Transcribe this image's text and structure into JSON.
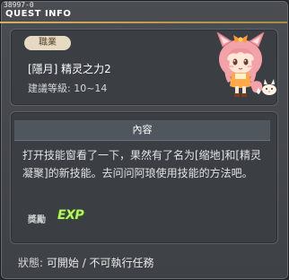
{
  "window": {
    "quest_id": "38997-0",
    "title": "QUEST INFO"
  },
  "job": {
    "badge_label": "職業",
    "name": "[隱月] 精灵之力2",
    "level_recommend": "建議等級: 10~14"
  },
  "content": {
    "header_label": "內容",
    "body_line1": "打开技能窗看了一下，果然有了名为[缩地]和[精灵",
    "body_line2": "凝聚]的新技能。去问问阿琅使用技能的方法吧。",
    "reward_label": "獎勵",
    "reward_icon_text": "EXP"
  },
  "status": {
    "label": "狀態:",
    "value": "可開始 / 不可執行任務"
  },
  "icons": {
    "npc": "fox-girl-npc-icon",
    "exp": "exp-icon"
  },
  "colors": {
    "title_underline": "#d6b062",
    "badge_bg": "#e6dac2",
    "exp_green": "#b7f06a"
  }
}
